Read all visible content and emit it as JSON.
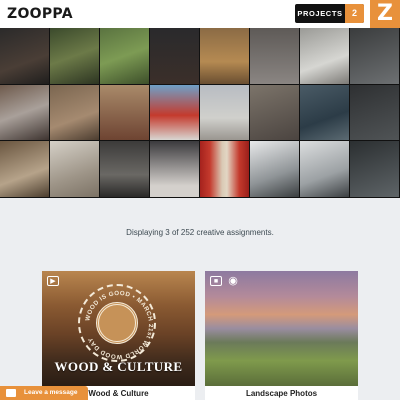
{
  "header": {
    "logo": "ZOOPPA",
    "projects_label": "PROJECTS",
    "projects_count": "2",
    "brand_mark": "Z"
  },
  "main": {
    "display_text": "Displaying 3 of 252 creative assignments."
  },
  "cards": [
    {
      "image_title": "WOOD & CULTURE",
      "circle_text": "WOOD IS GOOD • MARCH 21st WORLD WOOD DAY",
      "caption": "Wood & Culture",
      "icons": [
        "video-icon"
      ]
    },
    {
      "caption": "Landscape Photos",
      "icons": [
        "photo-icon",
        "audience-icon"
      ]
    }
  ],
  "chat": {
    "label": "Leave a message"
  },
  "colors": {
    "accent": "#e8913b",
    "background": "#eceef1",
    "topbar": "#ffffff",
    "text": "#3d4a52"
  }
}
